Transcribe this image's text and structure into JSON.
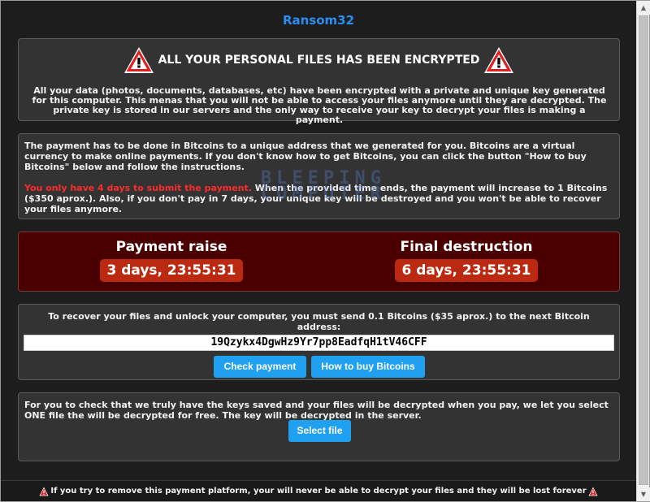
{
  "app": {
    "title": "Ransom32"
  },
  "banner": {
    "headline": "ALL YOUR PERSONAL FILES HAS BEEN ENCRYPTED",
    "body": "All your data (photos, documents, databases, etc) have been encrypted with a private and unique key generated for this computer. This menas that you will not be able to access your files anymore until they are decrypted. The private key is stored in our servers and the only way to receive your key to decrypt your files is making a payment.",
    "icon": "warning-triangle-icon"
  },
  "payment_info": {
    "paragraph1": "The payment has to be done in Bitcoins to a unique address that we generated for you. Bitcoins are a virtual currency to make online payments. If you don't know how to get Bitcoins, you can click the button \"How to buy Bitcoins\" below and follow the instructions.",
    "deadline_warning": "You only have 4 days to submit the payment.",
    "paragraph2_rest": " When the provided time ends, the payment will increase to 1 Bitcoins ($350 aprox.). Also, if you don't pay in 7 days, your unique key will be destroyed and you won't be able to recover your files anymore.",
    "watermark": "BLEEPING COMPUTER"
  },
  "timers": {
    "payment_raise_label": "Payment raise",
    "payment_raise_value": "3 days, 23:55:31",
    "final_destruction_label": "Final destruction",
    "final_destruction_value": "6 days, 23:55:31"
  },
  "bitcoin": {
    "instructions": "To recover your files and unlock your computer, you must send 0.1 Bitcoins ($35 aprox.) to the next Bitcoin address:",
    "address": "19Qzykx4DgwHz9Yr7pp8EadfqH1tV46CFF",
    "check_payment_label": "Check payment",
    "how_to_buy_label": "How to buy Bitcoins"
  },
  "test_decrypt": {
    "text": "For you to check that we truly have the keys saved and your files will be decrypted when you pay, we let you select ONE file the will be decrypted for free. The key will be decrypted in the server.",
    "select_file_label": "Select file"
  },
  "footer": {
    "warning": "If you try to remove this payment platform, your will never be able to decrypt your files and they will be lost forever"
  },
  "colors": {
    "title_blue": "#2a8ef0",
    "button_blue": "#1fa0f0",
    "alert_red": "#ff2b2b",
    "timer_panel": "#4a0000",
    "timer_badge": "#bb2a10"
  }
}
